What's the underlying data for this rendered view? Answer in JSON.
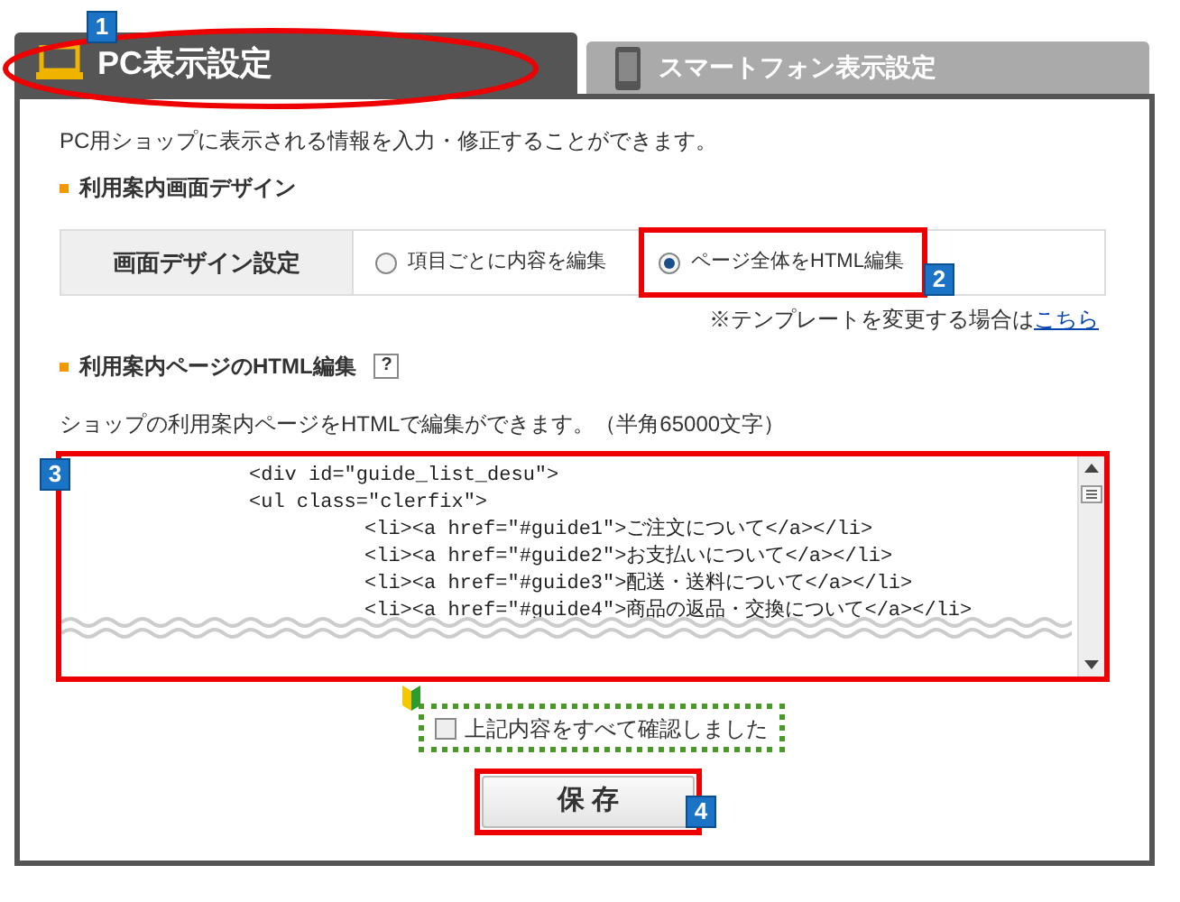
{
  "tabs": [
    {
      "label": "PC表示設定",
      "selected": true
    },
    {
      "label": "スマートフォン表示設定",
      "selected": false
    }
  ],
  "intro": "PC用ショップに表示される情報を入力・修正することができます。",
  "design_section": {
    "heading": "利用案内画面デザイン",
    "row_label": "画面デザイン設定",
    "options": [
      {
        "label": "項目ごとに内容を編集",
        "selected": false
      },
      {
        "label": "ページ全体をHTML編集",
        "selected": true
      }
    ],
    "template_note": "※テンプレートを変更する場合は",
    "template_link": "こちら"
  },
  "html_section": {
    "heading": "利用案内ページのHTML編集",
    "help": "?",
    "description": "ショップの利用案内ページをHTMLで編集ができます。（半角65000文字）",
    "code_lines": [
      {
        "text": "<div id=\"guide_list_desu\">"
      },
      {
        "text": "<ul class=\"clerfix\">",
        "children": [
          {
            "text": "<li><a href=\"#guide1\">ご注文について</a></li>"
          },
          {
            "text": "<li><a href=\"#guide2\">お支払いについて</a></li>"
          },
          {
            "text": "<li><a href=\"#guide3\">配送・送料について</a></li>"
          },
          {
            "text": "<li><a href=\"#guide4\">商品の返品・交換について</a></li>"
          }
        ]
      }
    ]
  },
  "confirm": {
    "label": "上記内容をすべて確認しました",
    "checked": false
  },
  "save_button": "保 存",
  "callouts": [
    "1",
    "2",
    "3",
    "4"
  ]
}
